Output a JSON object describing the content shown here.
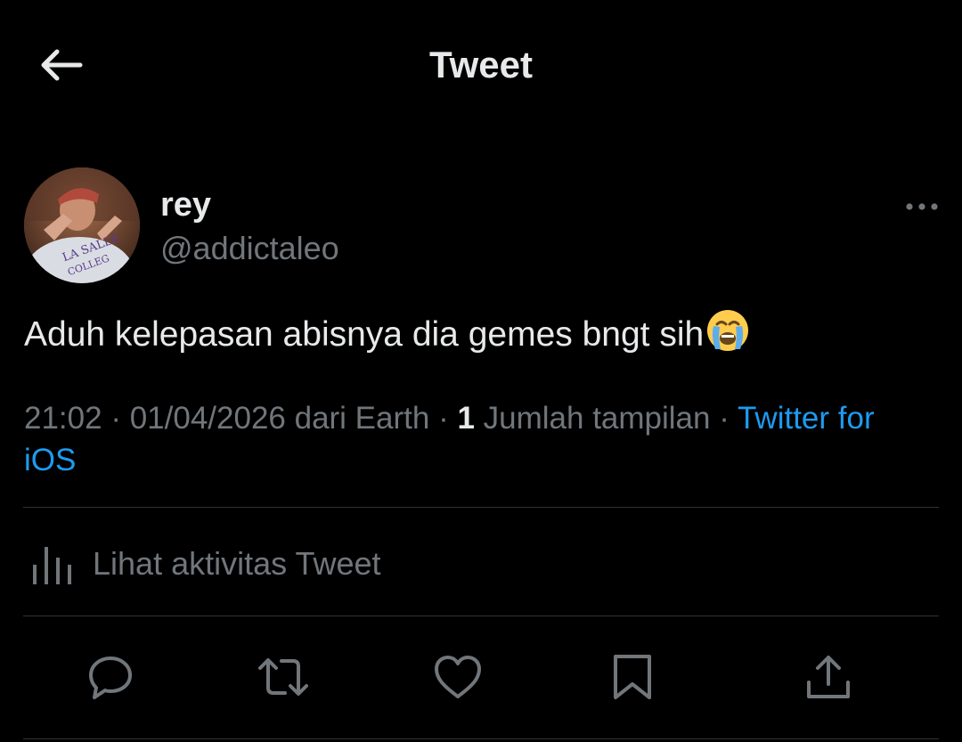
{
  "header": {
    "title": "Tweet",
    "back_icon": "arrow-left-icon"
  },
  "author": {
    "display_name": "rey",
    "handle": "@addictaleo",
    "avatar_icon": "user-avatar"
  },
  "tweet": {
    "text": "Aduh kelepasan abisnya dia gemes bngt sih",
    "emoji": "loudly-crying-face"
  },
  "meta": {
    "time": "21:02",
    "sep1": " · ",
    "date": "01/04/2026",
    "location": " dari Earth",
    "sep2": " · ",
    "views_count": "1",
    "views_label": " Jumlah tampilan",
    "sep3": " · ",
    "source": "Twitter for iOS"
  },
  "activity": {
    "label": "Lihat aktivitas Tweet",
    "icon": "analytics-icon"
  },
  "actions": [
    {
      "icon": "reply-icon"
    },
    {
      "icon": "retweet-icon"
    },
    {
      "icon": "like-icon"
    },
    {
      "icon": "bookmark-icon"
    },
    {
      "icon": "share-icon"
    }
  ],
  "colors": {
    "background": "#000000",
    "text": "#e7e9ea",
    "secondary": "#71767b",
    "link": "#1d9bf0",
    "divider": "#2f3336"
  }
}
